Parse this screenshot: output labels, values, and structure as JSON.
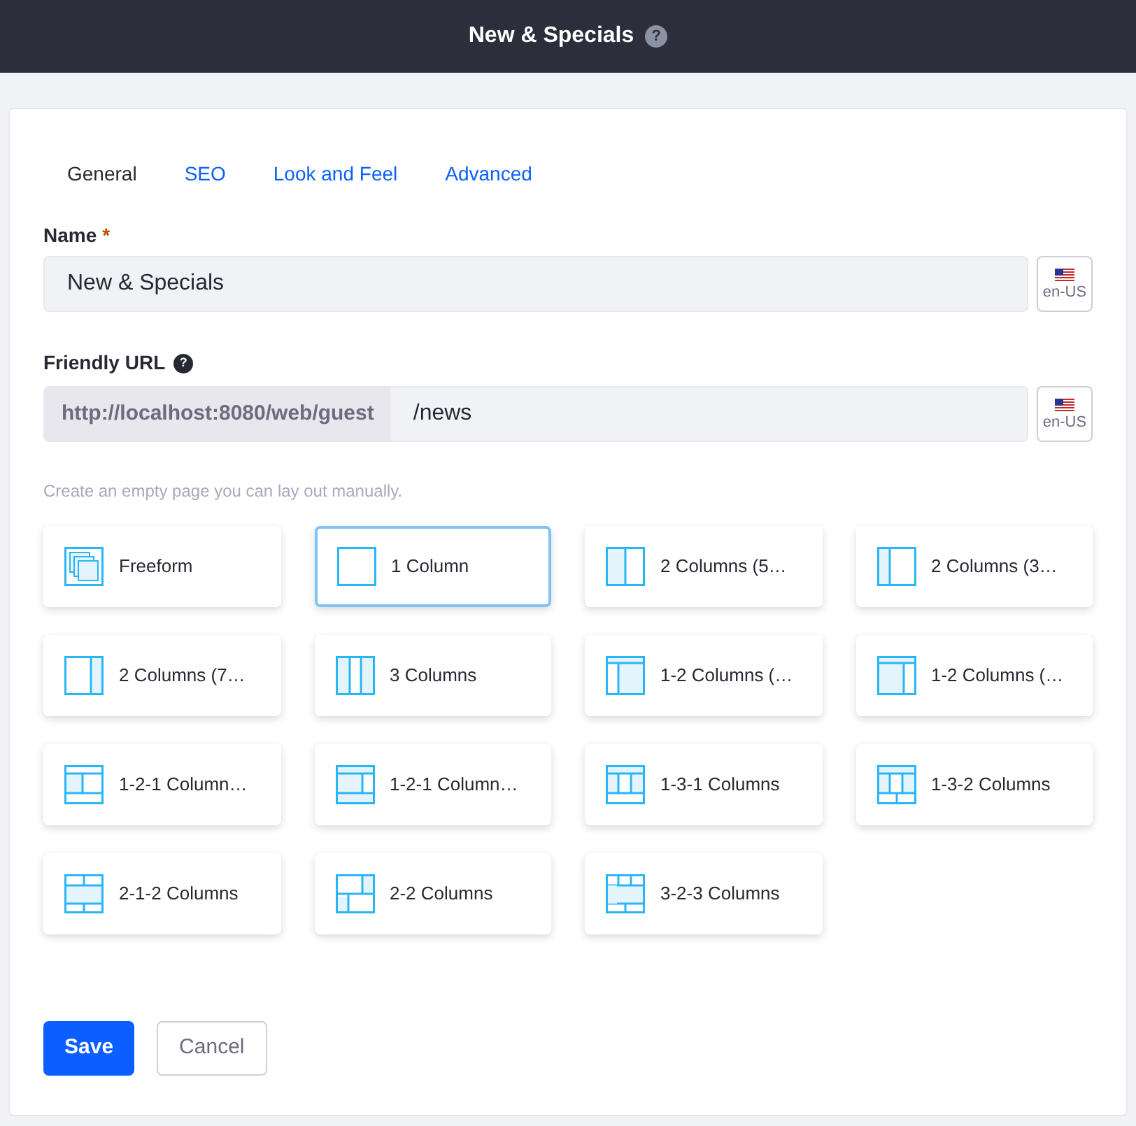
{
  "header": {
    "title": "New & Specials",
    "help": "?"
  },
  "tabs": [
    {
      "label": "General",
      "selected": true
    },
    {
      "label": "SEO",
      "selected": false
    },
    {
      "label": "Look and Feel",
      "selected": false
    },
    {
      "label": "Advanced",
      "selected": false
    }
  ],
  "name_field": {
    "label": "Name",
    "required_mark": "*",
    "value": "New & Specials",
    "locale": "en-US"
  },
  "url_field": {
    "label": "Friendly URL",
    "help": "?",
    "prefix": "http://localhost:8080/web/guest",
    "value": "/news",
    "locale": "en-US"
  },
  "hint": "Create an empty page you can lay out manually.",
  "templates": [
    {
      "label": "Freeform",
      "kind": "freeform",
      "selected": false
    },
    {
      "label": "1 Column",
      "kind": "c1",
      "selected": true
    },
    {
      "label": "2 Columns (5…",
      "kind": "c2_50",
      "selected": false
    },
    {
      "label": "2 Columns (3…",
      "kind": "c2_30",
      "selected": false
    },
    {
      "label": "2 Columns (7…",
      "kind": "c2_70",
      "selected": false
    },
    {
      "label": "3 Columns",
      "kind": "c3",
      "selected": false
    },
    {
      "label": "1-2 Columns (…",
      "kind": "c12a",
      "selected": false
    },
    {
      "label": "1-2 Columns (…",
      "kind": "c12b",
      "selected": false
    },
    {
      "label": "1-2-1 Column…",
      "kind": "c121a",
      "selected": false
    },
    {
      "label": "1-2-1 Column…",
      "kind": "c121b",
      "selected": false
    },
    {
      "label": "1-3-1 Columns",
      "kind": "c131",
      "selected": false
    },
    {
      "label": "1-3-2 Columns",
      "kind": "c132",
      "selected": false
    },
    {
      "label": "2-1-2 Columns",
      "kind": "c212",
      "selected": false
    },
    {
      "label": "2-2 Columns",
      "kind": "c22",
      "selected": false
    },
    {
      "label": "3-2-3 Columns",
      "kind": "c323",
      "selected": false
    }
  ],
  "buttons": {
    "save": "Save",
    "cancel": "Cancel"
  }
}
